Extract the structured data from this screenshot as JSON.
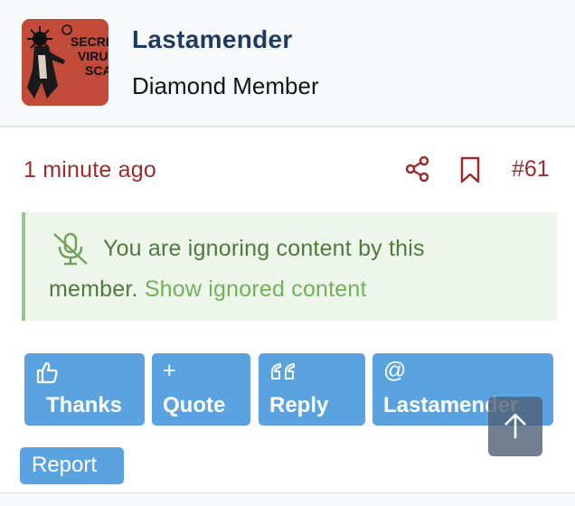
{
  "post": {
    "user": {
      "name": "Lastamender",
      "title": "Diamond Member",
      "avatar_icon": "avatar-secret-virus-scare",
      "avatar_text": [
        "SECRE",
        "VIRU",
        "SCA"
      ]
    },
    "meta": {
      "timestamp": "1 minute ago",
      "post_number": "#61",
      "share_icon": "share-icon",
      "bookmark_icon": "bookmark-icon"
    },
    "ignored_notice": {
      "icon": "microphone-slash-icon",
      "line1": "You are ignoring content by this",
      "line2_prefix": "member.",
      "show_link": "Show ignored content"
    },
    "actions": {
      "thanks": {
        "icon": "thumbs-up-icon",
        "label": "Thanks"
      },
      "quote": {
        "icon": "plus-icon",
        "glyph": "+",
        "label": "Quote"
      },
      "reply": {
        "icon": "quote-mark-icon",
        "label": "Reply"
      },
      "mention": {
        "icon": "at-icon",
        "glyph": "@",
        "label": "Lastamender"
      },
      "report": {
        "label": "Report"
      }
    },
    "scroll_top": {
      "icon": "arrow-up-icon"
    }
  },
  "colors": {
    "username": "#1f3a5f",
    "meta": "#9b2c2c",
    "notice_bg": "#eef6ec",
    "notice_text": "#4e7a3c",
    "notice_link": "#6fb259",
    "button_bg": "#5ba3e0",
    "avatar_bg": "#c24a38"
  }
}
